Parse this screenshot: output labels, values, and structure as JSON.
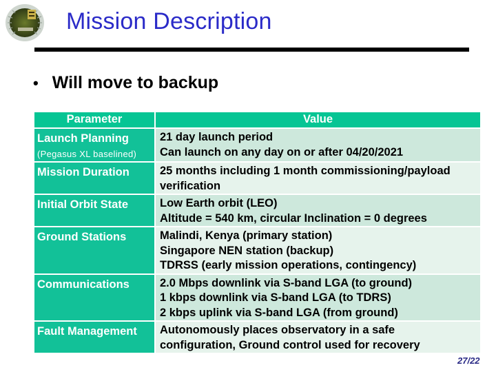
{
  "slide": {
    "title": "Mission Description",
    "bullet": "Will move to backup",
    "page_number": "27/22",
    "logo_icon": "emblem-seal-icon",
    "colors": {
      "title": "#2b2bc8",
      "header_fill": "#06c594",
      "param_fill": "#12c198",
      "row_dark": "#cde8dc",
      "row_light": "#e6f3ec",
      "page_number": "#2a2a86"
    }
  },
  "table": {
    "headers": [
      "Parameter",
      "Value"
    ],
    "rows": [
      {
        "parameter": "Launch Planning",
        "parameter_note": "(Pegasus XL baselined)",
        "values": [
          "21 day launch period",
          "Can launch on any day on or after 04/20/2021"
        ]
      },
      {
        "parameter": "Mission Duration",
        "values": [
          "25 months including 1 month commissioning/payload",
          "verification"
        ]
      },
      {
        "parameter": "Initial Orbit State",
        "values": [
          "Low Earth orbit (LEO)",
          "Altitude = 540 km, circular Inclination = 0 degrees"
        ]
      },
      {
        "parameter": "Ground Stations",
        "values": [
          "Malindi, Kenya (primary station)",
          "Singapore NEN station (backup)",
          "TDRSS (early mission operations, contingency)"
        ]
      },
      {
        "parameter": "Communications",
        "values": [
          "2.0 Mbps downlink via S-band LGA (to ground)",
          "1 kbps downlink via S-band LGA (to TDRS)",
          "2 kbps uplink via S-band LGA (from ground)"
        ]
      },
      {
        "parameter": "Fault Management",
        "values": [
          "Autonomously places observatory in a safe",
          "configuration, Ground control used for recovery"
        ]
      }
    ]
  }
}
